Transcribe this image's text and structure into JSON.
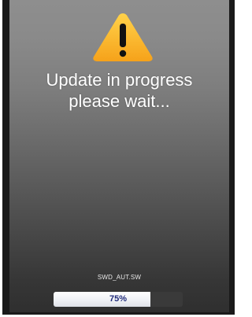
{
  "dialog": {
    "message_line1": "Update in progress",
    "message_line2": "please wait...",
    "icon": "warning-icon"
  },
  "progress": {
    "filename": "SWD_AUT.SW",
    "percent": 75,
    "label": "75%"
  },
  "colors": {
    "icon_orange": "#f6a21a",
    "icon_yellow": "#ffd24a",
    "progress_text": "#1f2a7a",
    "background_top": "#8e8e8e",
    "background_bottom": "#2f2f2f"
  }
}
